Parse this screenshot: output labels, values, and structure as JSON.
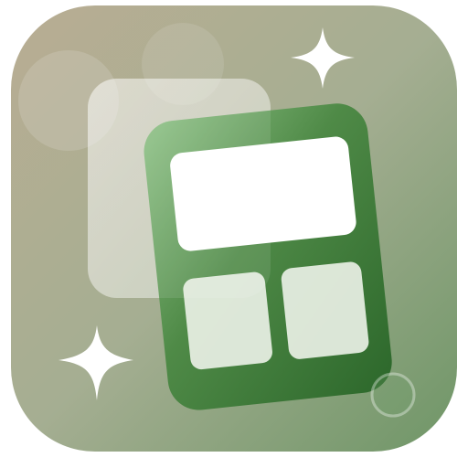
{
  "icon": {
    "kind": "app-icon",
    "subject": "widget-layout-icon",
    "colors": {
      "background_top_left": "#b9ad93",
      "background_mid": "#a5ae92",
      "background_bottom_right": "#6f9667",
      "widget_frame_light": "#8fc287",
      "widget_frame_mid": "#4f8a47",
      "widget_frame_dark": "#2f6a2d",
      "tile_white": "#ffffff",
      "tile_soft": "#e9f0e5",
      "sparkle": "#ffffff"
    }
  }
}
